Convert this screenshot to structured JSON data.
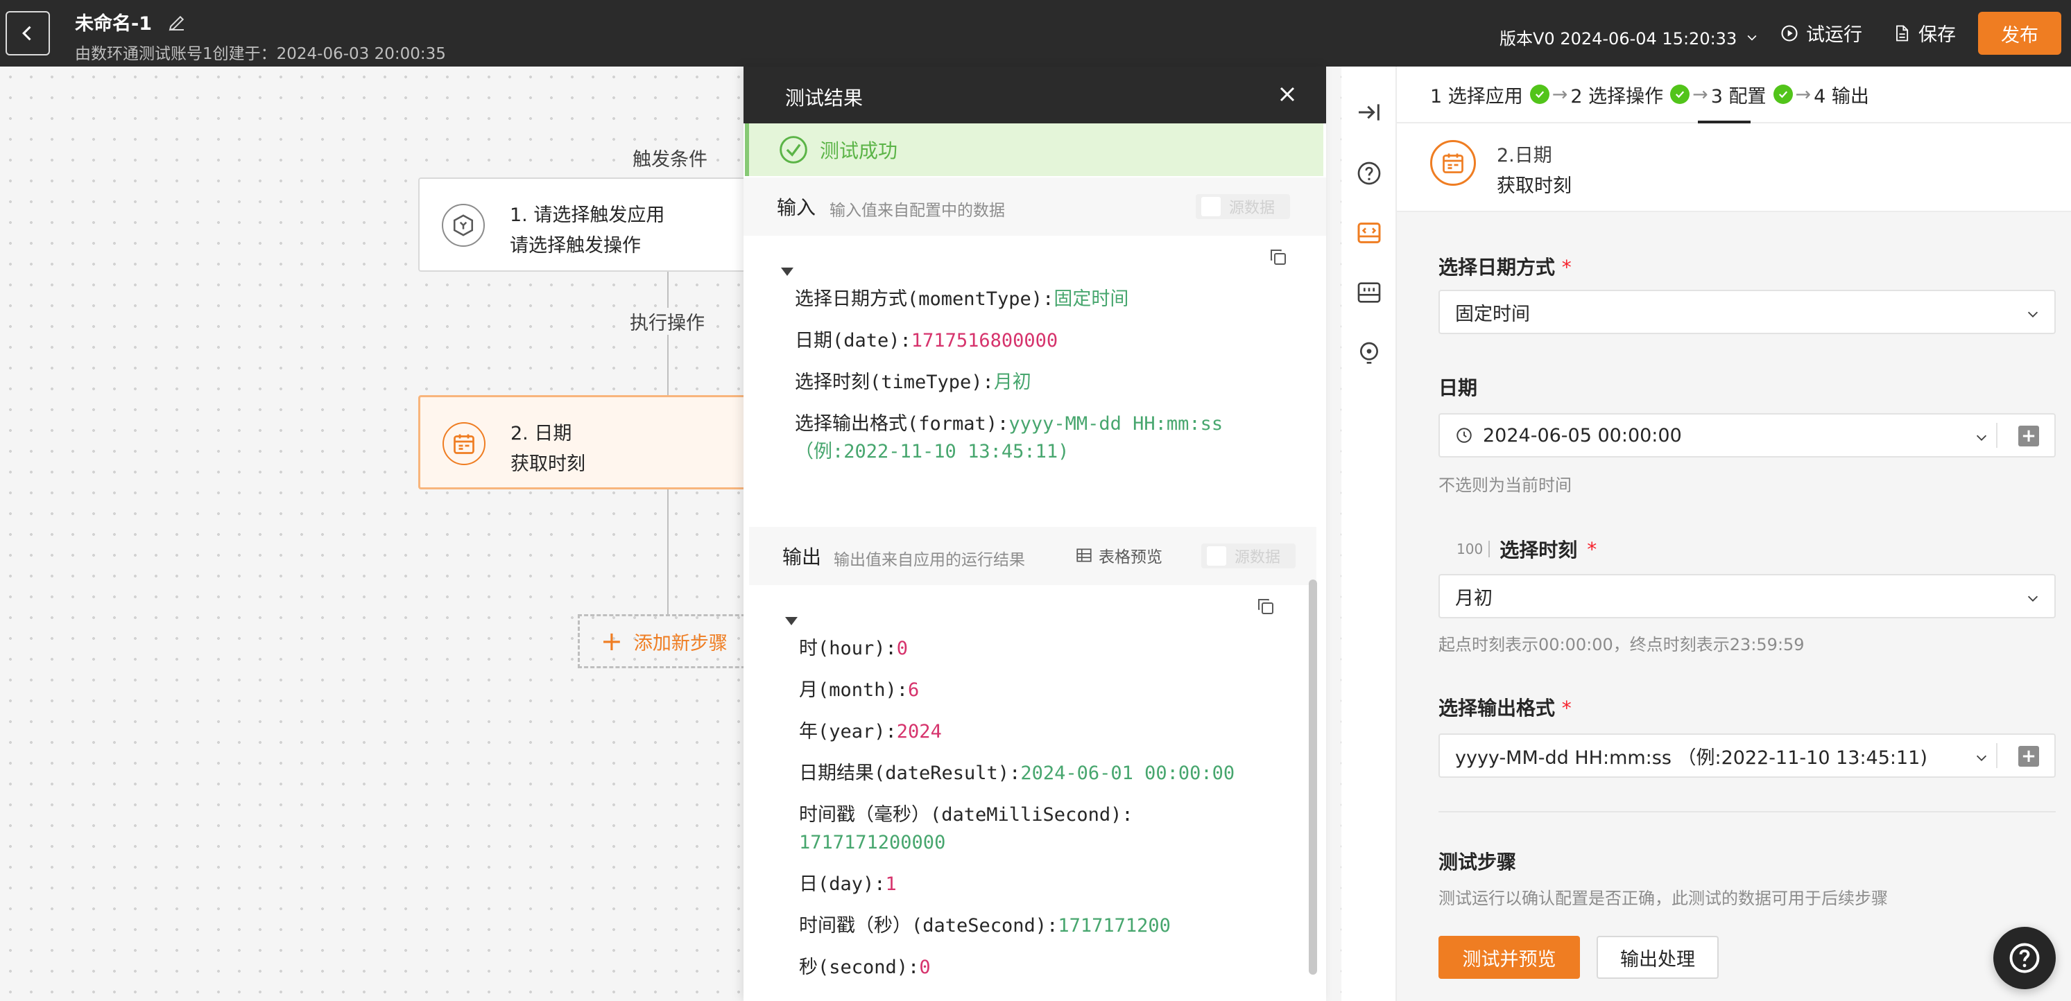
{
  "header": {
    "title": "未命名-1",
    "subtitle": "由数环通测试账号1创建于：2024-06-03 20:00:35",
    "version": "版本V0 2024-06-04 15:20:33",
    "trial_run": "试运行",
    "save": "保存",
    "publish": "发布"
  },
  "flow": {
    "trigger_label": "触发条件",
    "node1_line1": "1. 请选择触发应用",
    "node1_line2": "请选择触发操作",
    "action_label": "执行操作",
    "node2_line1": "2. 日期",
    "node2_line2": "获取时刻",
    "add_step": "添加新步骤"
  },
  "result_panel": {
    "title": "测试结果",
    "status": "测试成功",
    "input_title": "输入",
    "input_sub": "输入值来自配置中的数据",
    "raw_toggle": "源数据",
    "inputs": [
      {
        "key": "选择日期方式(momentType):",
        "value": "固定时间",
        "value2": ""
      },
      {
        "key": "日期(date):",
        "value": "1717516800000",
        "value2": ""
      },
      {
        "key": "选择时刻(timeType):",
        "value": "月初",
        "value2": ""
      },
      {
        "key": "选择输出格式(format):",
        "value": "yyyy-MM-dd HH:mm:ss",
        "value2": "（例:2022-11-10 13:45:11)"
      }
    ],
    "output_title": "输出",
    "output_sub": "输出值来自应用的运行结果",
    "table_preview": "表格预览",
    "outputs": [
      {
        "key": "时(hour):",
        "value": "0"
      },
      {
        "key": "月(month):",
        "value": "6"
      },
      {
        "key": "年(year):",
        "value": "2024"
      },
      {
        "key": "日期结果(dateResult):",
        "value": "2024-06-01 00:00:00"
      },
      {
        "key": "时间戳（毫秒）(dateMilliSecond):",
        "value": "1717171200000"
      },
      {
        "key": "日(day):",
        "value": "1"
      },
      {
        "key": "时间戳（秒）(dateSecond):",
        "value": "1717171200"
      },
      {
        "key": "秒(second):",
        "value": "0"
      }
    ]
  },
  "config": {
    "steps": [
      "1 选择应用",
      "2 选择操作",
      "3 配置",
      "4 输出"
    ],
    "app_line1": "2.日期",
    "app_line2": "获取时刻",
    "date_mode_label": "选择日期方式",
    "date_mode_value": "固定时间",
    "date_label": "日期",
    "date_value": "2024-06-05 00:00:00",
    "date_hint": "不选则为当前时间",
    "time_prefix": "100",
    "time_label": "选择时刻",
    "time_value": "月初",
    "time_hint": "起点时刻表示00:00:00，终点时刻表示23:59:59",
    "format_label": "选择输出格式",
    "format_value": "yyyy-MM-dd HH:mm:ss （例:2022-11-10 13:45:11)",
    "test_title": "测试步骤",
    "test_desc": "测试运行以确认配置是否正确，此测试的数据可用于后续步骤",
    "test_button": "测试并预览",
    "output_button": "输出处理"
  },
  "colors": {
    "accent": "#ef7d22",
    "success": "#52c41a",
    "value_green": "#47a66e",
    "value_red": "#d6336c"
  }
}
